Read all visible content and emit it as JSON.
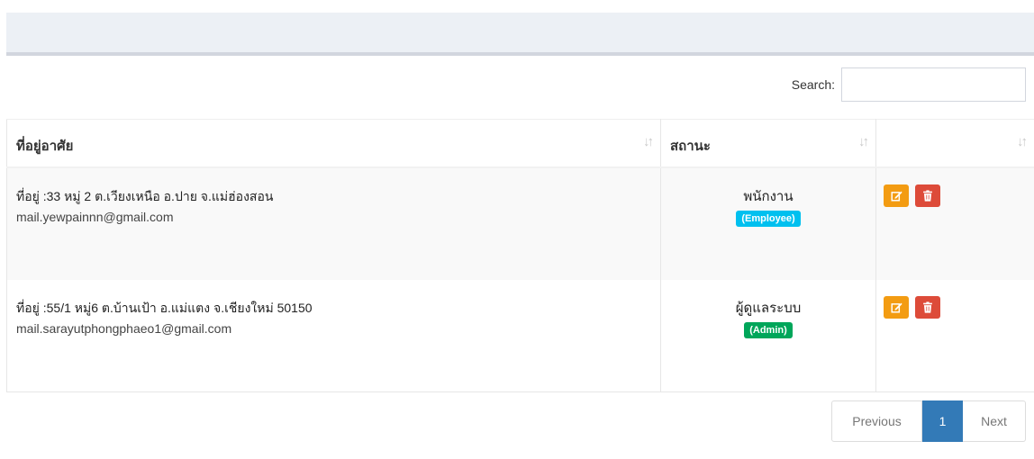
{
  "search": {
    "label": "Search:",
    "value": "",
    "placeholder": ""
  },
  "table": {
    "headers": [
      {
        "label": "ที่อยู่อาศัย",
        "sort_icon": "sort-icon"
      },
      {
        "label": "สถานะ",
        "sort_icon": "sort-icon"
      },
      {
        "label": "",
        "sort_icon": "sort-icon"
      }
    ],
    "rows": [
      {
        "address": "ที่อยู่ :33 หมู่ 2 ต.เวียงเหนือ อ.ปาย จ.แม่ฮ่องสอน",
        "email": "mail.yewpainnn@gmail.com",
        "status": "พนักงาน",
        "badge": "(Employee)",
        "badge_color": "#00c0ef"
      },
      {
        "address": "ที่อยู่ :55/1 หมู่6 ต.บ้านเป้า อ.แม่แตง จ.เชียงใหม่ 50150",
        "email": "mail.sarayutphongphaeo1@gmail.com",
        "status": "ผู้ดูแลระบบ",
        "badge": "(Admin)",
        "badge_color": "#00a65a"
      }
    ],
    "action_icons": [
      "edit-icon",
      "trash-icon"
    ],
    "action_colors": {
      "edit": "#f39c12",
      "delete": "#dd4b39"
    }
  },
  "pagination": {
    "previous": "Previous",
    "current": "1",
    "next": "Next",
    "active_color": "#337ab7"
  }
}
